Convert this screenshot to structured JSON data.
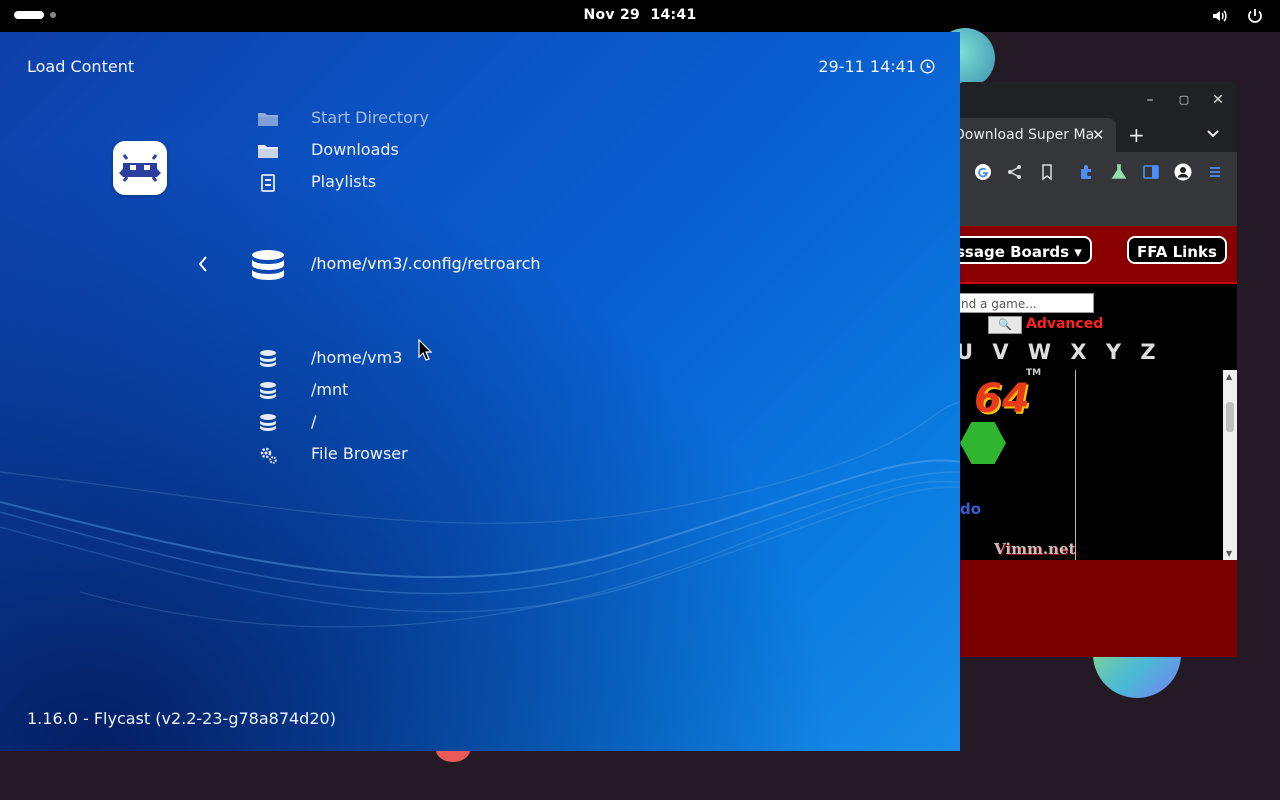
{
  "topbar": {
    "date": "Nov 29",
    "time": "14:41",
    "icons": [
      "volume-icon",
      "power-icon"
    ]
  },
  "browser": {
    "tab_title": "Download Super Ma",
    "new_tab_symbol": "+",
    "close_symbol": "✕",
    "page": {
      "button_message_boards": "ssage Boards ▾",
      "button_ffa_links": "FFA Links",
      "search_placeholder": "nd a game...",
      "search_button": "🔍",
      "advanced_link": "Advanced",
      "letters": "U V W X Y Z",
      "logo_number": "64",
      "logo_tm": "TM",
      "logo_partial": "do",
      "site_logo": "Vimm.net"
    }
  },
  "retroarch": {
    "title": "Load Content",
    "clock": "29-11 14:41",
    "menu_top": [
      {
        "label": "Start Directory",
        "icon": "folder-icon"
      },
      {
        "label": "Downloads",
        "icon": "folder-icon"
      },
      {
        "label": "Playlists",
        "icon": "playlist-icon"
      }
    ],
    "selected": {
      "label": "/home/vm3/.config/retroarch",
      "icon": "database-icon"
    },
    "menu_bottom": [
      {
        "label": "/home/vm3",
        "icon": "database-icon"
      },
      {
        "label": "/mnt",
        "icon": "database-icon"
      },
      {
        "label": "/",
        "icon": "database-icon"
      },
      {
        "label": "File Browser",
        "icon": "gears-icon"
      }
    ],
    "version": "1.16.0 - Flycast (v2.2-23-g78a874d20)"
  }
}
